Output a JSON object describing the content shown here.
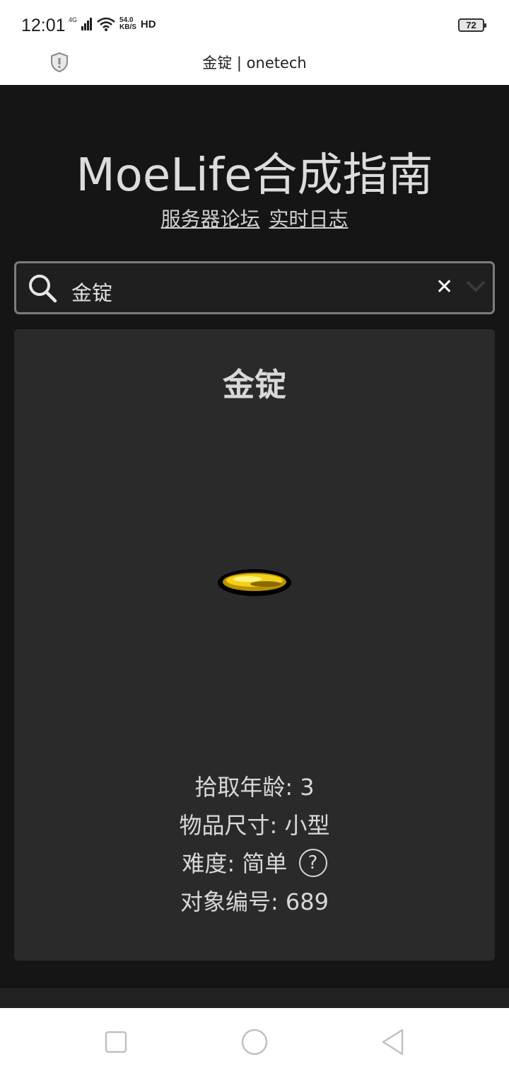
{
  "status_bar": {
    "time": "12:01",
    "network": "4G",
    "speed_value": "54.0",
    "speed_unit": "KB/S",
    "hd": "HD",
    "battery": "72"
  },
  "url_bar": {
    "title": "金锭 | onetech",
    "icon": "shield-icon"
  },
  "header": {
    "title": "MoeLife合成指南",
    "links": [
      "服务器论坛",
      "实时日志"
    ]
  },
  "search": {
    "value": "金锭",
    "icon": "search-icon",
    "clear_icon": "close-icon",
    "dropdown_icon": "chevron-down-icon"
  },
  "item": {
    "name": "金锭",
    "image": "gold-ingot",
    "pickup_age": "拾取年龄: 3",
    "size": "物品尺寸: 小型",
    "difficulty": "难度: 简单",
    "help": "?",
    "object_id": "对象编号: 689"
  },
  "colors": {
    "page_bg": "#151515",
    "card_bg": "#2a2a2a",
    "text": "#d8d8d8",
    "gold": "#f2d01c"
  }
}
